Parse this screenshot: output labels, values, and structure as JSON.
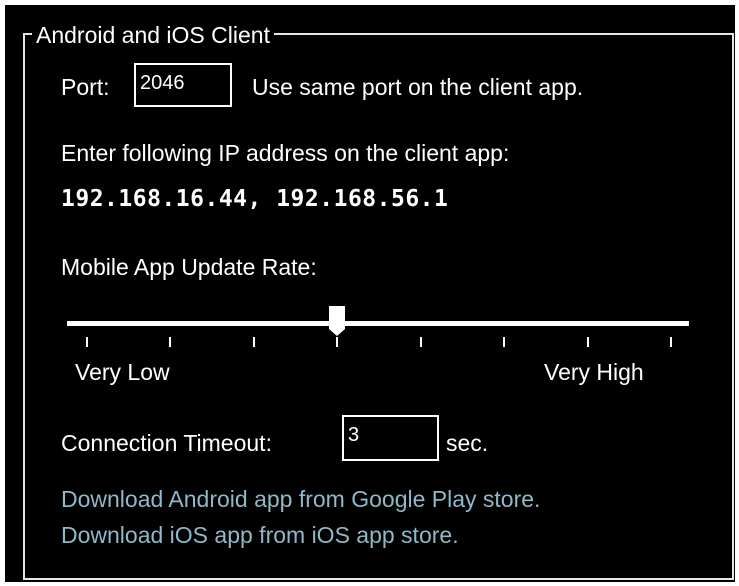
{
  "group": {
    "title": "Android and iOS Client"
  },
  "port": {
    "label": "Port:",
    "value": "2046",
    "hint": "Use same port on the client app."
  },
  "ip": {
    "instruction": "Enter following IP address on the client app:",
    "addresses": "192.168.16.44, 192.168.56.1"
  },
  "update_rate": {
    "label": "Mobile App Update Rate:",
    "min_label": "Very Low",
    "max_label": "Very High",
    "tick_count": 8,
    "selected_tick_index": 3
  },
  "timeout": {
    "label": "Connection Timeout:",
    "value": "3",
    "unit": "sec."
  },
  "links": {
    "android": "Download Android app from Google Play store.",
    "ios": "Download iOS app from iOS app store."
  },
  "colors": {
    "background": "#000000",
    "text": "#ffffff",
    "link": "#8fb8c8"
  }
}
